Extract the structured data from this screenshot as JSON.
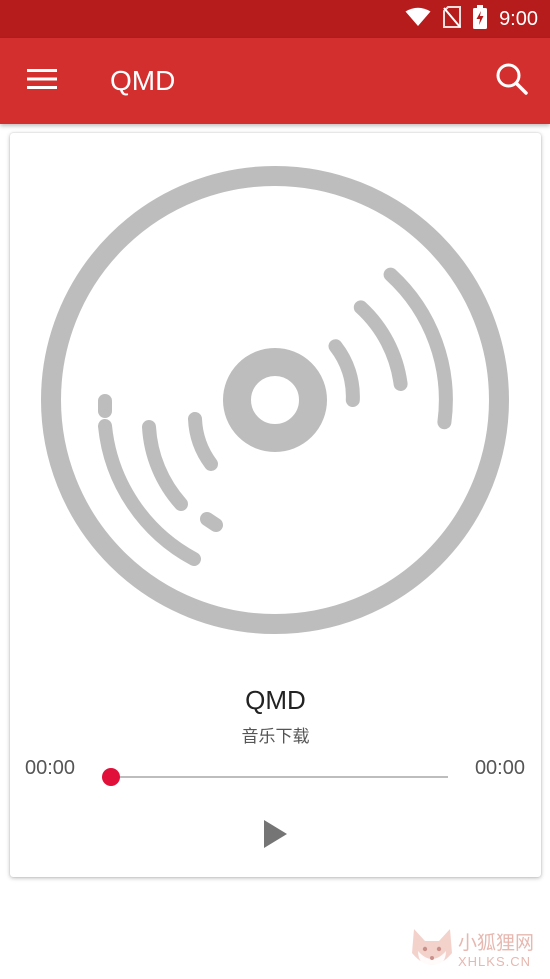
{
  "status_bar": {
    "time": "9:00",
    "icons": [
      "wifi-icon",
      "no-sim-icon",
      "battery-charging-icon"
    ]
  },
  "app_bar": {
    "menu_icon": "hamburger-menu-icon",
    "title": "QMD",
    "search_icon": "search-icon"
  },
  "player": {
    "album_art_icon": "vinyl-disc-icon",
    "track_title": "QMD",
    "track_artist": "音乐下载",
    "current_time": "00:00",
    "total_time": "00:00",
    "progress": 0,
    "play_icon": "play-icon"
  },
  "watermark": {
    "cn": "小狐狸网",
    "en": "XHLKS.CN"
  },
  "colors": {
    "status_bar": "#B71C1C",
    "app_bar": "#D32F2F",
    "accent": "#E0103A",
    "disc_gray": "#BDBDBD",
    "icon_gray": "#757575"
  }
}
